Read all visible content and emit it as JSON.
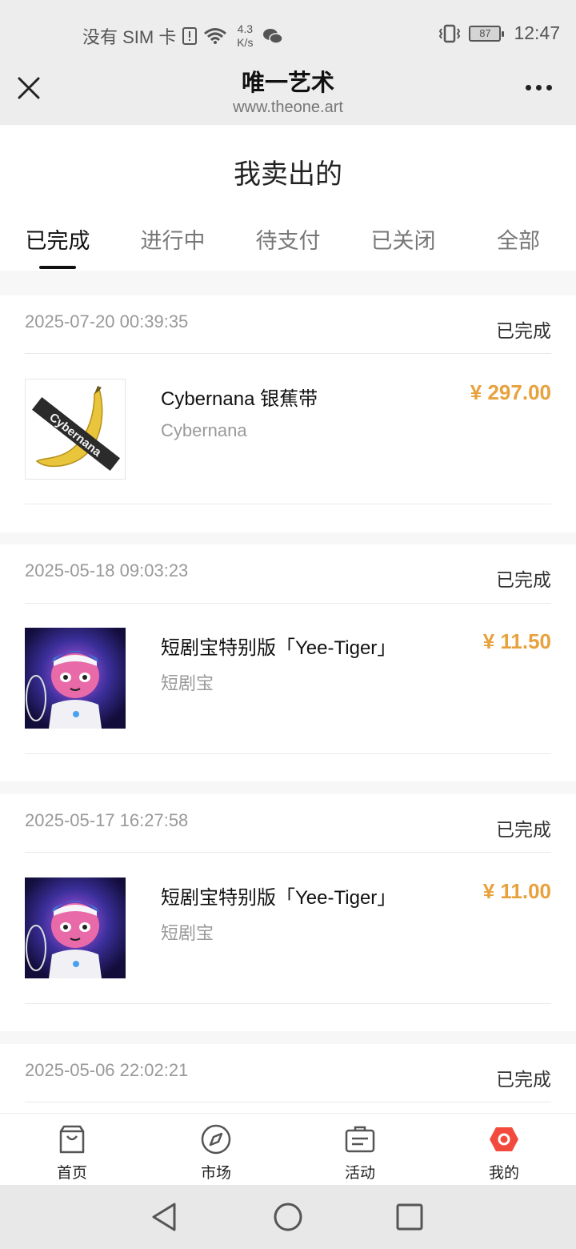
{
  "status_bar": {
    "carrier": "没有 SIM 卡",
    "speed_value": "4.3",
    "speed_unit": "K/s",
    "battery": "87",
    "time": "12:47"
  },
  "title_bar": {
    "title": "唯一艺术",
    "url": "www.theone.art"
  },
  "page": {
    "title": "我卖出的"
  },
  "tabs": [
    {
      "label": "已完成",
      "active": true
    },
    {
      "label": "进行中",
      "active": false
    },
    {
      "label": "待支付",
      "active": false
    },
    {
      "label": "已关闭",
      "active": false
    },
    {
      "label": "全部",
      "active": false
    }
  ],
  "orders": [
    {
      "date": "2025-07-20 00:39:35",
      "status": "已完成",
      "name": "Cybernana 银蕉带",
      "sub": "Cybernana",
      "price": "¥ 297.00",
      "thumb": "banana-image",
      "thumb_text": "Cybernana"
    },
    {
      "date": "2025-05-18 09:03:23",
      "status": "已完成",
      "name": "短剧宝特别版「Yee-Tiger」",
      "sub": "短剧宝",
      "price": "¥ 11.50",
      "thumb": "tiger-image"
    },
    {
      "date": "2025-05-17 16:27:58",
      "status": "已完成",
      "name": "短剧宝特别版「Yee-Tiger」",
      "sub": "短剧宝",
      "price": "¥ 11.00",
      "thumb": "tiger-image"
    },
    {
      "date": "2025-05-06 22:02:21",
      "status": "已完成"
    }
  ],
  "bottom_nav": [
    {
      "label": "首页",
      "icon": "bag-icon"
    },
    {
      "label": "市场",
      "icon": "compass-icon"
    },
    {
      "label": "活动",
      "icon": "ticket-icon"
    },
    {
      "label": "我的",
      "icon": "profile-hexagon-icon"
    }
  ],
  "colors": {
    "price": "#e8a23d",
    "my_active": "#f24b3d"
  }
}
